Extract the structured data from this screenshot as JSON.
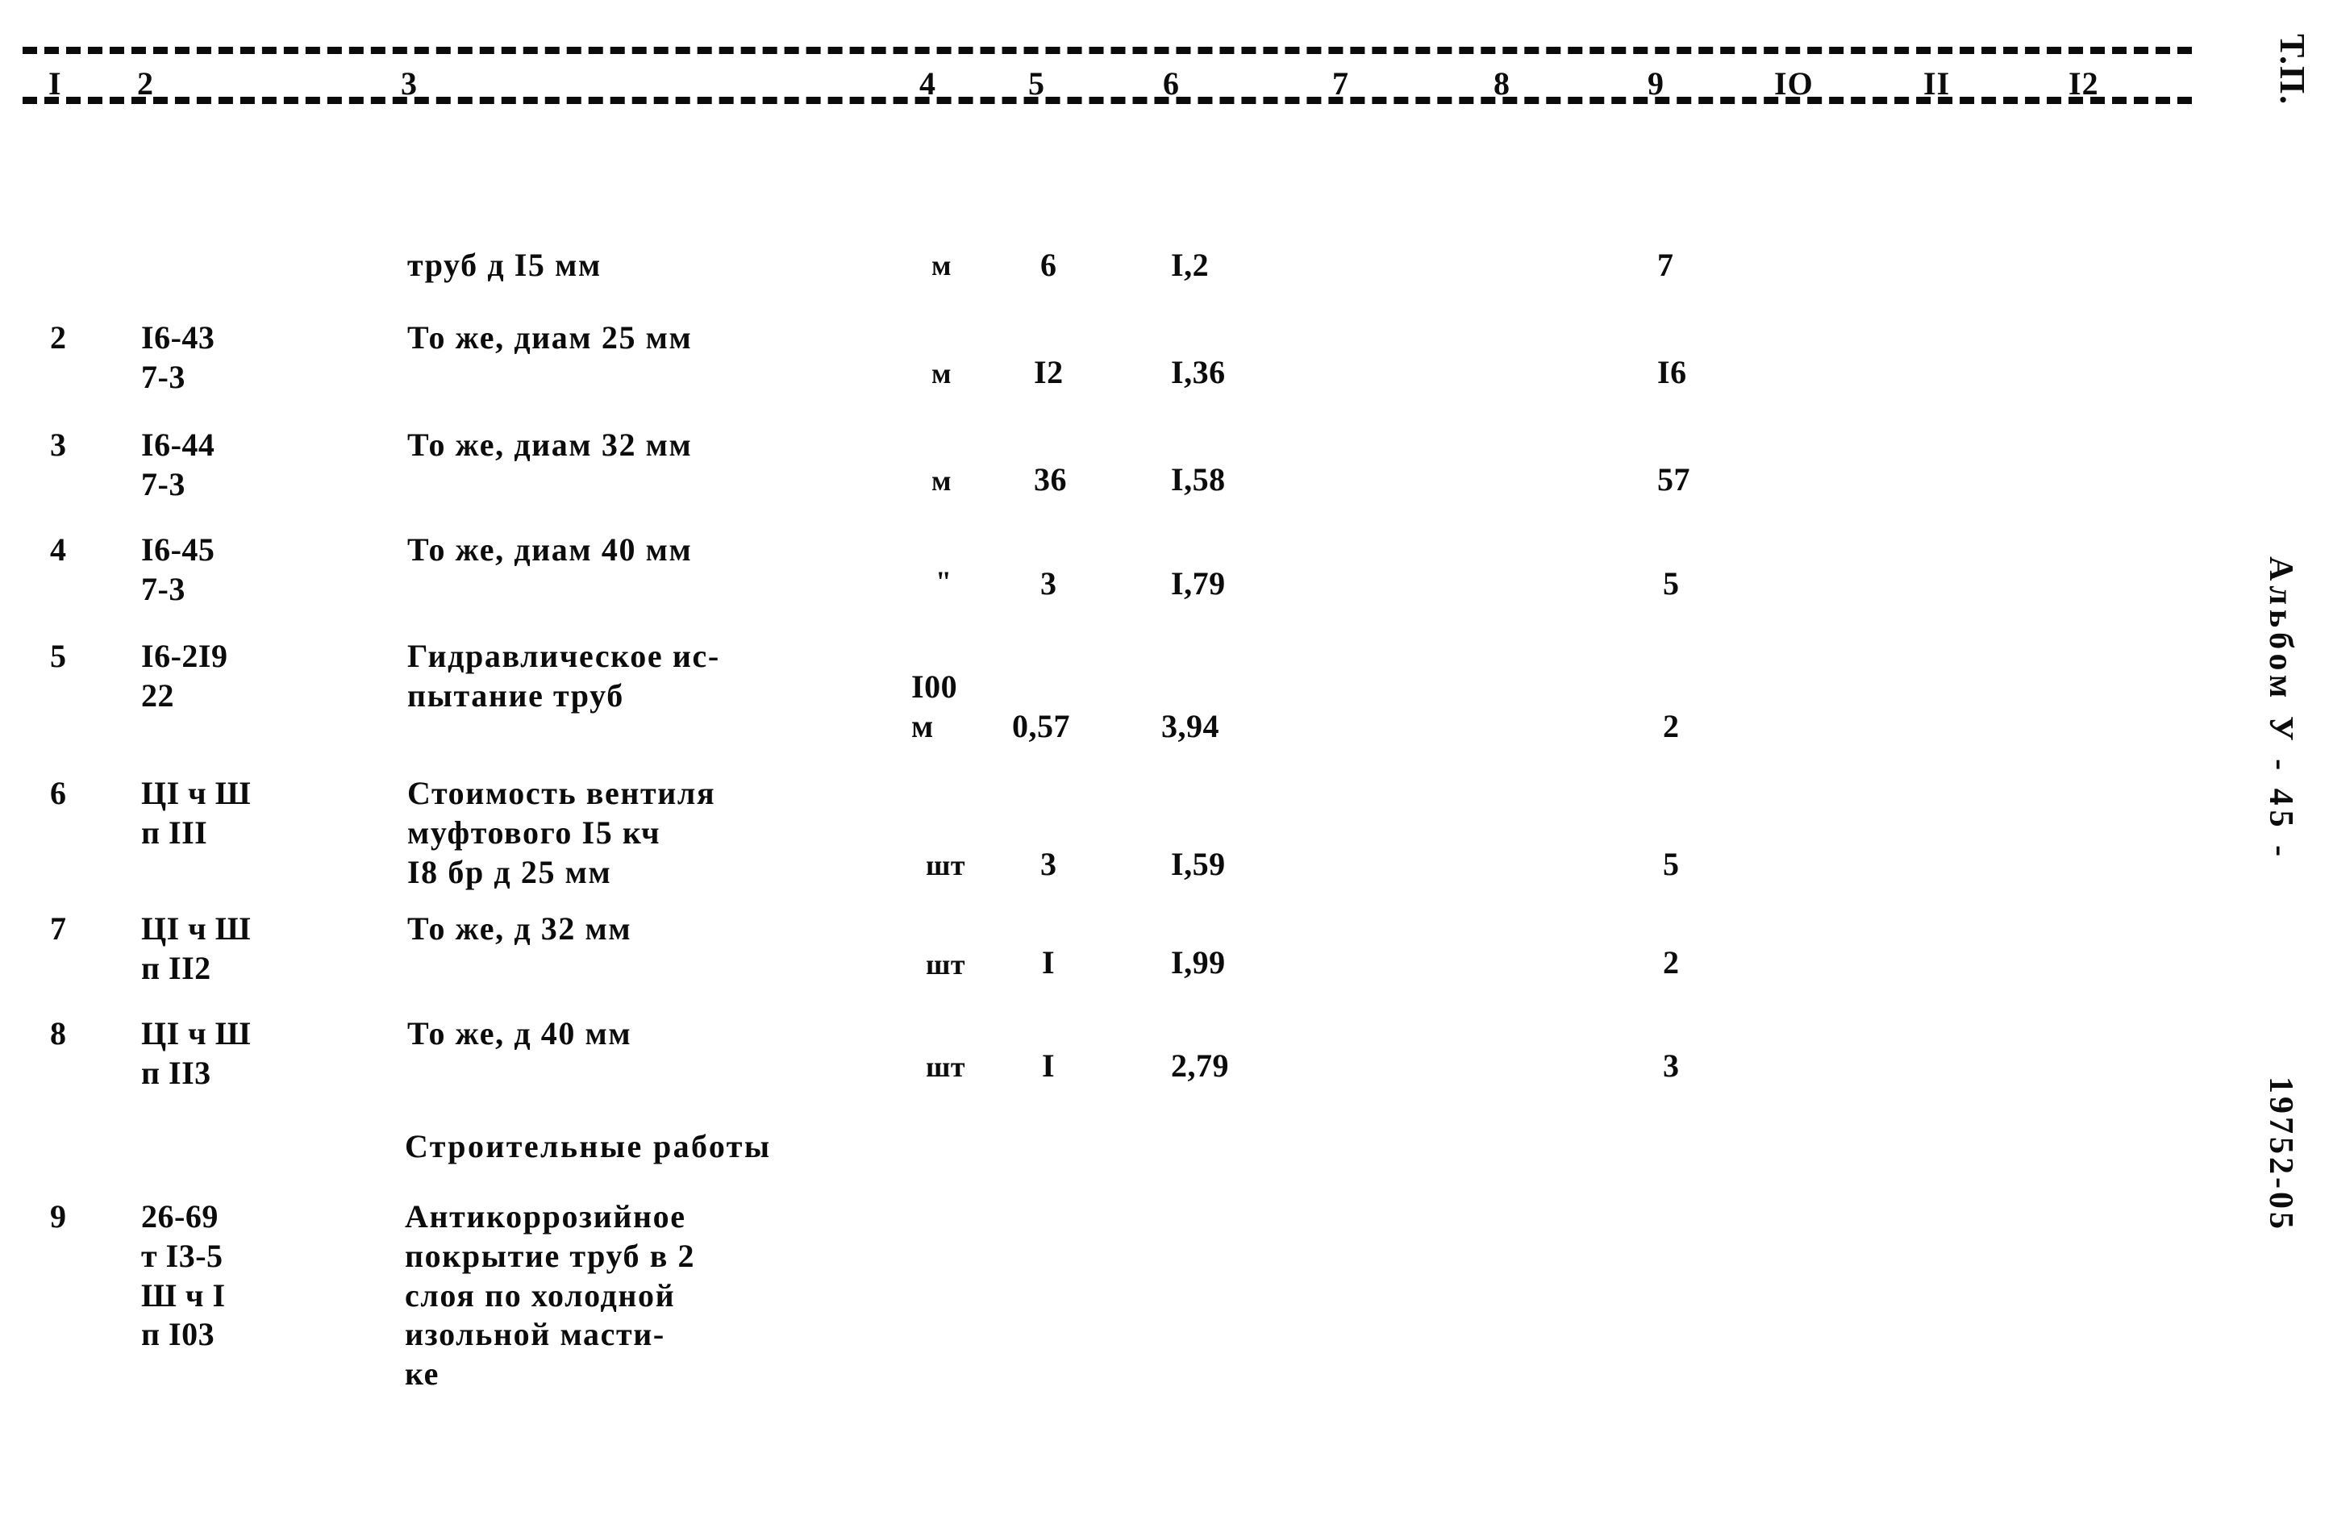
{
  "document": {
    "side_marks": {
      "top_right": "Т.П.",
      "album": "Альбом У - 45 -",
      "doc_id": "19752-05"
    }
  },
  "table": {
    "column_numbers": [
      "I",
      "2",
      "3",
      "4",
      "5",
      "6",
      "7",
      "8",
      "9",
      "IO",
      "II",
      "I2"
    ],
    "rows": [
      {
        "pos": "",
        "code": "",
        "desc": "труб д I5 мм",
        "unit": "м",
        "qty": "6",
        "price": "I,2",
        "c7": "",
        "c8": "",
        "total": "7",
        "c10": "",
        "c11": "",
        "c12": ""
      },
      {
        "pos": "2",
        "code": "I6-43\n7-3",
        "desc": "То же, диам 25 мм",
        "unit": "м",
        "qty": "I2",
        "price": "I,36",
        "c7": "",
        "c8": "",
        "total": "I6",
        "c10": "",
        "c11": "",
        "c12": ""
      },
      {
        "pos": "3",
        "code": "I6-44\n7-3",
        "desc": "То же, диам 32 мм",
        "unit": "м",
        "qty": "36",
        "price": "I,58",
        "c7": "",
        "c8": "",
        "total": "57",
        "c10": "",
        "c11": "",
        "c12": ""
      },
      {
        "pos": "4",
        "code": "I6-45\n7-3",
        "desc": "То же, диам 40 мм",
        "unit": "\"",
        "qty": "3",
        "price": "I,79",
        "c7": "",
        "c8": "",
        "total": "5",
        "c10": "",
        "c11": "",
        "c12": ""
      },
      {
        "pos": "5",
        "code": "I6-2I9\n22",
        "desc": "Гидравлическое ис-\nпытание труб",
        "unit": "I00\nм",
        "qty": "0,57",
        "price": "3,94",
        "c7": "",
        "c8": "",
        "total": "2",
        "c10": "",
        "c11": "",
        "c12": ""
      },
      {
        "pos": "6",
        "code": "ЦI ч Ш\nп III",
        "desc": "Стоимость вентиля\nмуфтового I5 кч\nI8 бр д 25 мм",
        "unit": "шт",
        "qty": "3",
        "price": "I,59",
        "c7": "",
        "c8": "",
        "total": "5",
        "c10": "",
        "c11": "",
        "c12": ""
      },
      {
        "pos": "7",
        "code": "ЦI ч Ш\nп II2",
        "desc": "То же, д 32 мм",
        "unit": "шт",
        "qty": "I",
        "price": "I,99",
        "c7": "",
        "c8": "",
        "total": "2",
        "c10": "",
        "c11": "",
        "c12": ""
      },
      {
        "pos": "8",
        "code": "ЦI ч Ш\nп II3",
        "desc": "То же, д 40 мм",
        "unit": "шт",
        "qty": "I",
        "price": "2,79",
        "c7": "",
        "c8": "",
        "total": "3",
        "c10": "",
        "c11": "",
        "c12": ""
      },
      {
        "pos": "9",
        "code": "26-69\nт I3-5\nШ ч I\nп I03",
        "desc": "Антикоррозийное\nпокрытие труб в 2\nслоя по холодной\nизольной масти-\nке",
        "unit": "",
        "qty": "",
        "price": "",
        "c7": "",
        "c8": "",
        "total": "",
        "c10": "",
        "c11": "",
        "c12": ""
      }
    ],
    "section_title": "Строительные работы"
  }
}
